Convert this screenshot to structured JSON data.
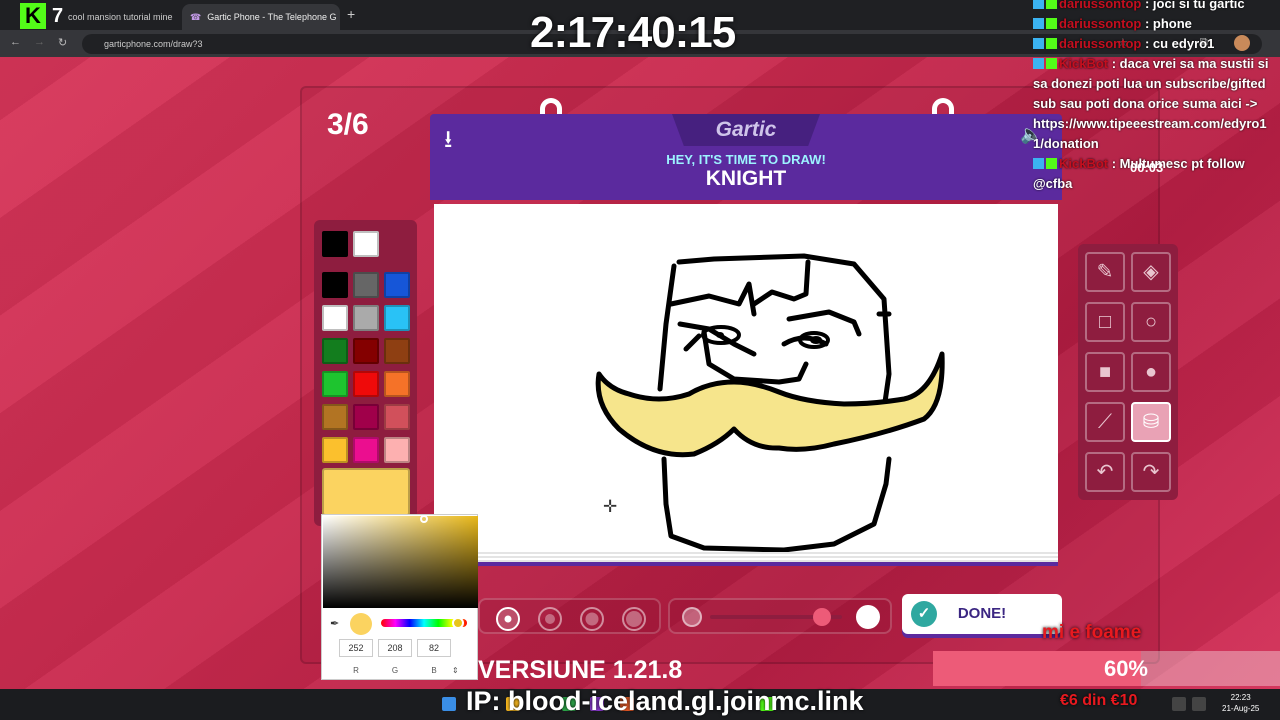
{
  "browser": {
    "tabs": [
      {
        "title": "cool mansion tutorial mine",
        "active": false
      },
      {
        "title": "Gartic Phone - The Telephone G",
        "active": true
      }
    ],
    "new_tab": "+",
    "url": "garticphone.com/draw?3",
    "k_badge_number": "7"
  },
  "stream": {
    "timer": "2:17:40:15",
    "version": "VERSIUNE 1.21.8",
    "ip": "IP: blood-iceland.gl.joinmc.link",
    "goal_title": "mi e foame",
    "goal_percent_label": "60%",
    "goal_percent": 60,
    "goal_amount": "€6 din €10"
  },
  "chat": {
    "messages": [
      {
        "user": "dariussontop",
        "text": "joci si tu gartic"
      },
      {
        "user": "dariussontop",
        "text": "phone"
      },
      {
        "user": "dariussontop",
        "text": "cu edyro1"
      },
      {
        "user": "KickBot",
        "text": "daca vrei sa ma sustii si sa donezi poti lua un subscribe/gifted sub sau poti dona orice suma aici -> https://www.tipeeestream.com/edyro1 1/donation"
      },
      {
        "user": "KickBot",
        "text": "Multumesc pt follow @cfba"
      }
    ],
    "timer_overlay": "00:03"
  },
  "game": {
    "round": "3/6",
    "logo": "Gartic",
    "prompt": "HEY, IT'S TIME TO DRAW!",
    "word": "KNIGHT",
    "done_label": "DONE!",
    "palette": [
      "#000000",
      "#ffffff",
      "#000000",
      "#666666",
      "#1656d8",
      "#ffffff",
      "#aaaaaa",
      "#29c2f6",
      "#137d1e",
      "#840000",
      "#8e3f12",
      "#1ec42f",
      "#ef0a0a",
      "#f57228",
      "#b27423",
      "#a0004a",
      "#d1505b",
      "#fbc02d",
      "#eb0e8f",
      "#fdb0b0"
    ],
    "selected_color": "#fbd360",
    "picker": {
      "r": "252",
      "g": "208",
      "b": "82",
      "label_r": "R",
      "label_g": "G",
      "label_b": "B",
      "arrows": "⇕"
    },
    "tools": [
      {
        "name": "pencil-icon",
        "glyph": "✎"
      },
      {
        "name": "eraser-icon",
        "glyph": "◈"
      },
      {
        "name": "square-outline-icon",
        "glyph": "□"
      },
      {
        "name": "circle-outline-icon",
        "glyph": "○"
      },
      {
        "name": "square-filled-icon",
        "glyph": "■"
      },
      {
        "name": "circle-filled-icon",
        "glyph": "●"
      },
      {
        "name": "line-icon",
        "glyph": "⟋"
      },
      {
        "name": "bucket-icon",
        "glyph": "⛁"
      },
      {
        "name": "undo-icon",
        "glyph": "↶"
      },
      {
        "name": "redo-icon",
        "glyph": "↷"
      }
    ],
    "active_tool": 7,
    "brush_sizes": [
      1,
      2,
      3,
      4
    ],
    "selected_brush": 0,
    "opacity_level": 0.85
  },
  "taskbar": {
    "time": "22:23",
    "date": "21-Aug-25"
  }
}
